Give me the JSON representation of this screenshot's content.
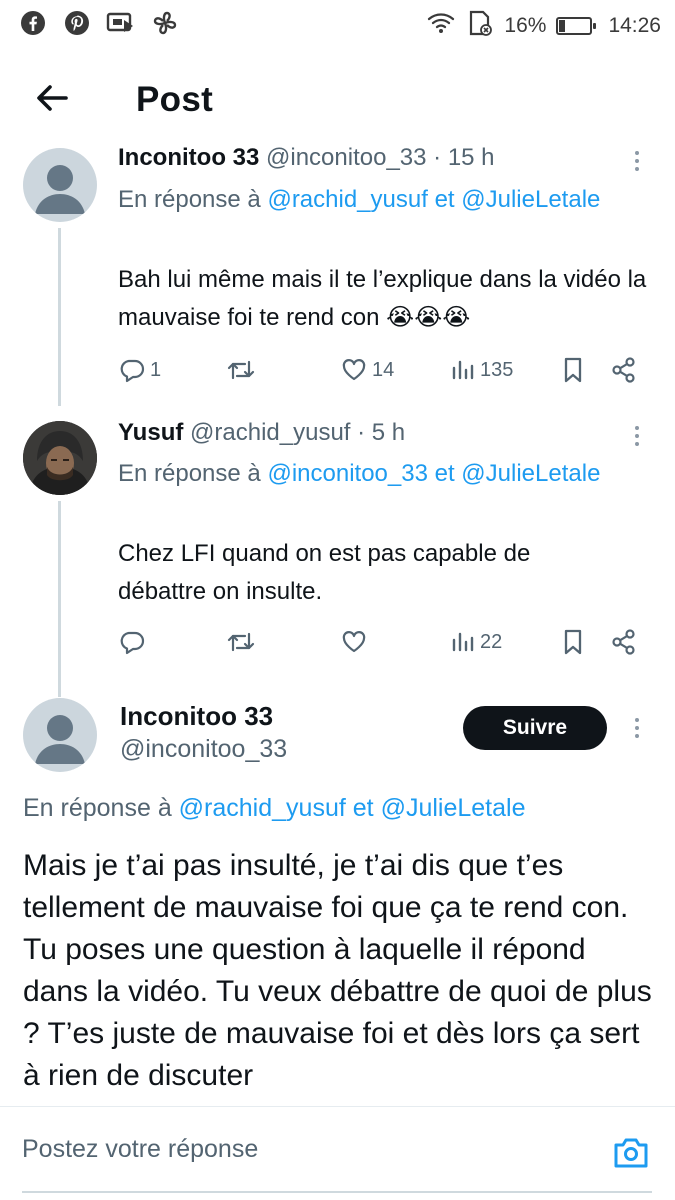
{
  "status_bar": {
    "left_icons": [
      "facebook-icon",
      "pinterest-icon",
      "ticket-icon",
      "fan-icon"
    ],
    "battery_percent": "16%",
    "battery_level": 0.16,
    "time": "14:26"
  },
  "header": {
    "title": "Post"
  },
  "tweets": [
    {
      "name": "Inconitoo 33",
      "meta": "@inconitoo_33 · 15 h",
      "reply_prefix": "En réponse à",
      "reply_mention1": "@rachid_yusuf",
      "reply_and": "et",
      "reply_mention2": "@JulieLetale",
      "text": "Bah lui même mais il te l’explique dans la vidéo la mauvaise foi te rend con 😭😭😭",
      "replies": "1",
      "retweets": "",
      "likes": "14",
      "views": "135"
    },
    {
      "name": "Yusuf",
      "meta": "@rachid_yusuf · 5 h",
      "reply_prefix": "En réponse à",
      "reply_mention1": "@inconitoo_33",
      "reply_and": "et",
      "reply_mention2": "@JulieLetale",
      "text": "Chez LFI quand on est pas capable de débattre on insulte.",
      "replies": "",
      "retweets": "",
      "likes": "",
      "views": "22"
    }
  ],
  "main_post": {
    "name": "Inconitoo 33",
    "handle": "@inconitoo_33",
    "follow_label": "Suivre",
    "reply_prefix": "En réponse à",
    "reply_mention1": "@rachid_yusuf",
    "reply_and": "et",
    "reply_mention2": "@JulieLetale",
    "text": "Mais je t’ai pas insulté, je t’ai dis que t’es tellement de mauvaise foi que ça te rend con. Tu poses une question à laquelle il répond dans la vidéo. Tu veux débattre de quoi de plus ? T’es juste de mauvaise foi et dès lors ça sert à rien de discuter"
  },
  "reply_bar": {
    "placeholder": "Postez votre réponse"
  },
  "colors": {
    "accent": "#1d9bf0",
    "text": "#0f1419",
    "secondary": "#536471",
    "divider": "#cfd9de"
  }
}
